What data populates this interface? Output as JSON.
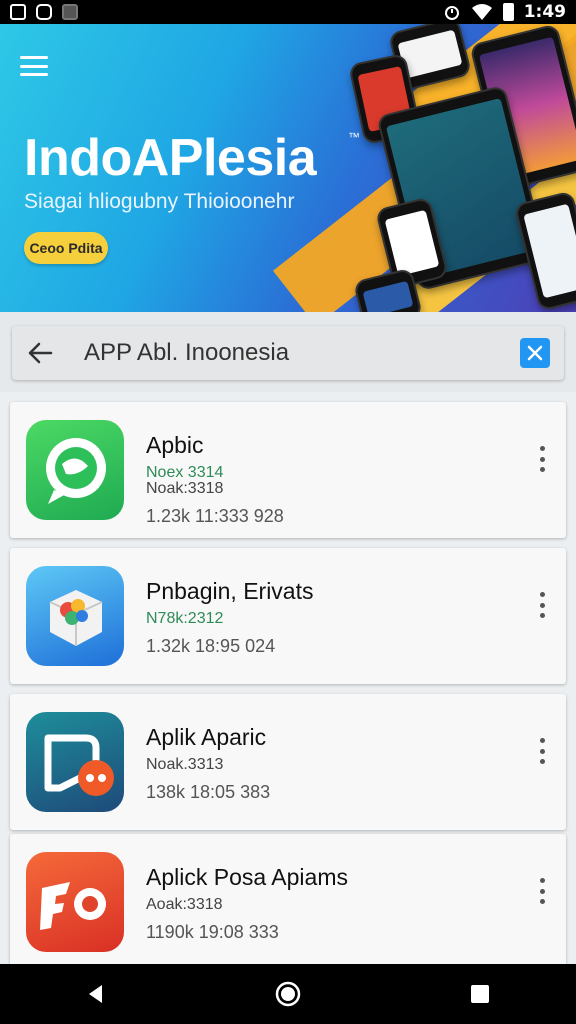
{
  "status_bar": {
    "time": "1:49",
    "left_icons": [
      "notification-icon",
      "notification-icon",
      "notification-icon"
    ],
    "right_icons": [
      "alarm-icon",
      "wifi-icon",
      "battery-icon"
    ]
  },
  "banner": {
    "title": "IndoAPlesia",
    "trademark": "™",
    "subtitle": "Siagai hliogubny Thioioonehr",
    "cta_label": "Ceoo Pdita",
    "colors": {
      "primary": "#1fa6e4",
      "accent": "#f7a823"
    }
  },
  "search": {
    "value": "APP Abl. Inoonesia",
    "back_icon": "arrow-left-icon",
    "clear_icon": "close-icon",
    "clear_color": "#2196f3"
  },
  "apps": [
    {
      "name": "Apbic",
      "line1": "Noex 3314",
      "line2": "Noak:3318",
      "line3": "1.23k 11:333 928",
      "icon": "chat-bubble-icon"
    },
    {
      "name": "Pnbagin, Erivats",
      "line1": "N78k:2312",
      "line3": "1.32k 18:95 024",
      "icon": "cube-icon"
    },
    {
      "name": "Aplik Aparic",
      "line1": "Noak.3313",
      "line3": "138k 18:05 383",
      "icon": "message-icon"
    },
    {
      "name": "Aplick Posa Apiams",
      "line1": "Aoak:3318",
      "line3": "1190k 19:08 333",
      "icon": "fo-logo-icon"
    }
  ],
  "nav_bar": {
    "buttons": [
      "back-icon",
      "home-icon",
      "recents-icon"
    ]
  }
}
